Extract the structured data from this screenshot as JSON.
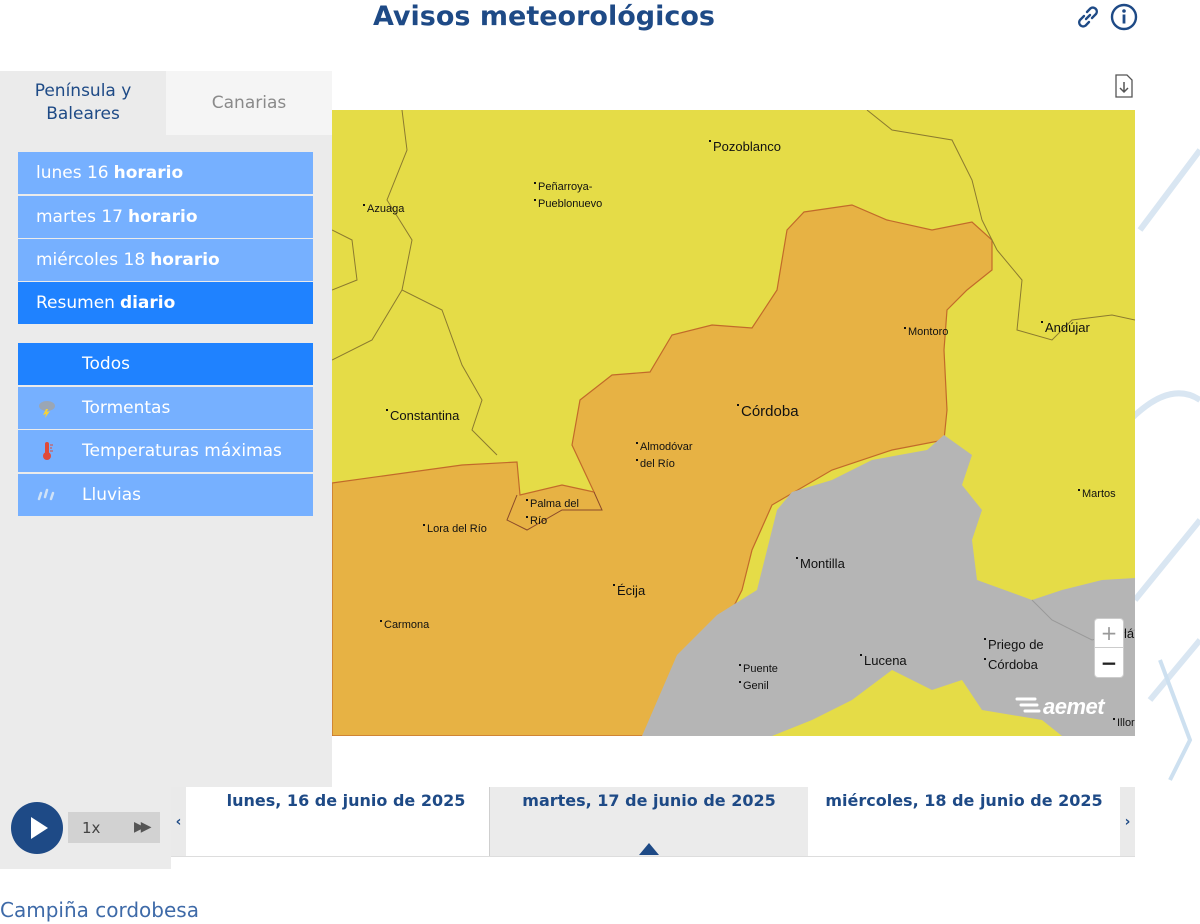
{
  "header": {
    "title": "Avisos meteorológicos",
    "icons": [
      "link-icon",
      "info-icon"
    ]
  },
  "region_tabs": [
    {
      "label": "Península y Baleares",
      "active": true
    },
    {
      "label": "Canarias",
      "active": false
    }
  ],
  "day_menu": [
    {
      "day": "lunes 16",
      "mode": "horario",
      "active": false
    },
    {
      "day": "martes 17",
      "mode": "horario",
      "active": false
    },
    {
      "day": "miércoles 18",
      "mode": "horario",
      "active": false
    },
    {
      "day": "Resumen",
      "mode": "diario",
      "active": true
    }
  ],
  "phenomena_filter": [
    {
      "label": "Todos",
      "icon": "",
      "active": true
    },
    {
      "label": "Tormentas",
      "icon": "storm-icon",
      "active": false
    },
    {
      "label": "Temperaturas máximas",
      "icon": "thermometer-icon",
      "active": false
    },
    {
      "label": "Lluvias",
      "icon": "rain-icon",
      "active": false
    }
  ],
  "map": {
    "colors": {
      "yellow": "#e5dc47",
      "orange": "#e7b244",
      "grey": "#b5b5b5"
    },
    "cities": [
      "Pozoblanco",
      "Peñarroya-",
      "Pueblonuevo",
      "Azuaga",
      "Montoro",
      "Andújar",
      "Constantina",
      "Córdoba",
      "Almodóvar",
      "del Río",
      "Martos",
      "Palma del",
      "Río",
      "Lora del Río",
      "Montilla",
      "Écija",
      "Carmona",
      "Priego de",
      "Córdoba",
      "Lucena",
      "Puente",
      "Genil",
      "Illor",
      "lá"
    ],
    "zoom_in": "+",
    "zoom_out": "−",
    "logo": "aemet"
  },
  "player": {
    "speed": "1x"
  },
  "timeline": {
    "days": [
      "lunes, 16 de junio de 2025",
      "martes, 17 de junio de 2025",
      "miércoles, 18 de junio de 2025"
    ],
    "selected_index": 1,
    "prev": "‹",
    "next": "›"
  },
  "zone": {
    "title": "Campiña cordobesa"
  }
}
